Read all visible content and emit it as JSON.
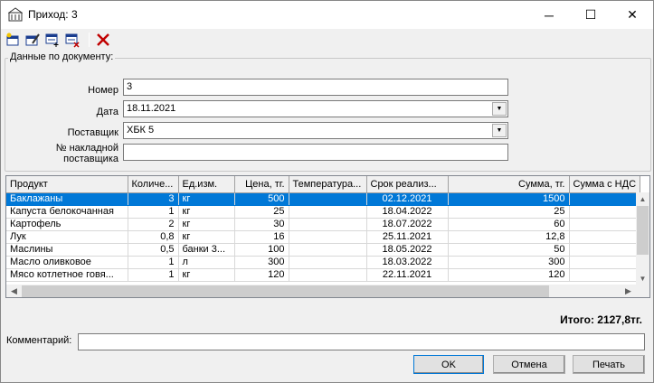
{
  "window": {
    "title": "Приход: 3",
    "minimize": "─",
    "maximize": "☐",
    "close": "✕"
  },
  "toolbar": {
    "icons": [
      "new-icon",
      "edit-icon",
      "add-row-icon",
      "delete-row-icon",
      "delete-icon"
    ]
  },
  "form": {
    "group_title": "Данные по документу:",
    "number_label": "Номер",
    "number_value": "3",
    "date_label": "Дата",
    "date_value": "18.11.2021",
    "supplier_label": "Поставщик",
    "supplier_value": "ХБК 5",
    "invoice_label_1": "№ накладной",
    "invoice_label_2": "поставщика",
    "invoice_value": ""
  },
  "grid": {
    "columns": [
      "Продукт",
      "Количе...",
      "Ед.изм.",
      "Цена, тг.",
      "Температура...",
      "Срок реализ...",
      "Сумма, тг.",
      "Сумма с НДС"
    ],
    "rows": [
      [
        "Баклажаны",
        "3",
        "кг",
        "500",
        "",
        "02.12.2021",
        "1500",
        ""
      ],
      [
        "Капуста белокочанная",
        "1",
        "кг",
        "25",
        "",
        "18.04.2022",
        "25",
        ""
      ],
      [
        "Картофель",
        "2",
        "кг",
        "30",
        "",
        "18.07.2022",
        "60",
        ""
      ],
      [
        "Лук",
        "0,8",
        "кг",
        "16",
        "",
        "25.11.2021",
        "12,8",
        ""
      ],
      [
        "Маслины",
        "0,5",
        "банки 3...",
        "100",
        "",
        "18.05.2022",
        "50",
        ""
      ],
      [
        "Масло оливковое",
        "1",
        "л",
        "300",
        "",
        "18.03.2022",
        "300",
        ""
      ],
      [
        "Мясо котлетное говя...",
        "1",
        "кг",
        "120",
        "",
        "22.11.2021",
        "120",
        ""
      ]
    ],
    "selected_row": 0
  },
  "total": "Итого: 2127,8тг.",
  "comment": {
    "label": "Комментарий:",
    "value": ""
  },
  "buttons": {
    "ok": "OK",
    "cancel": "Отмена",
    "print": "Печать"
  },
  "colors": {
    "selection": "#0078d7",
    "delete_icon": "#c00000"
  }
}
